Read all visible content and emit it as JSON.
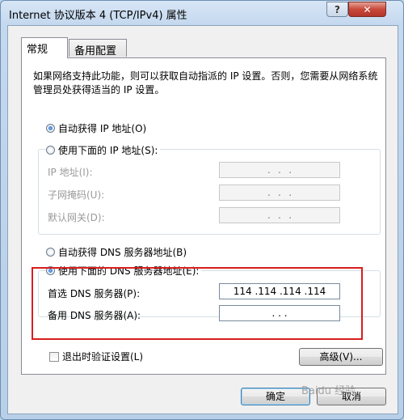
{
  "window": {
    "title": "Internet 协议版本 4 (TCP/IPv4) 属性",
    "help_label": "?",
    "close_label": "✕"
  },
  "tabs": [
    {
      "label": "常规",
      "active": true
    },
    {
      "label": "备用配置",
      "active": false
    }
  ],
  "description": "如果网络支持此功能，则可以获取自动指派的 IP 设置。否则，您需要从网络系统管理员处获得适当的 IP 设置。",
  "ip_section": {
    "auto_label": "自动获得 IP 地址(O)",
    "manual_label": "使用下面的 IP 地址(S):",
    "selected": "auto",
    "fields": [
      {
        "label": "IP 地址(I):",
        "value": ".   .   ."
      },
      {
        "label": "子网掩码(U):",
        "value": ".   .   ."
      },
      {
        "label": "默认网关(D):",
        "value": ".   .   ."
      }
    ]
  },
  "dns_section": {
    "auto_label": "自动获得 DNS 服务器地址(B)",
    "manual_label": "使用下面的 DNS 服务器地址(E):",
    "selected": "manual",
    "preferred_label": "首选 DNS 服务器(P):",
    "preferred_value": "114 .114 .114 .114",
    "alternate_label": "备用 DNS 服务器(A):",
    "alternate_value": ".   .   ."
  },
  "validate_label": "退出时验证设置(L)",
  "advanced_label": "高级(V)...",
  "ok_label": "确定",
  "cancel_label": "取消",
  "watermark": "Baidu 经验",
  "colors": {
    "highlight": "#d81e1e",
    "titlebar": "#c4d8ee",
    "close": "#c8493a"
  }
}
